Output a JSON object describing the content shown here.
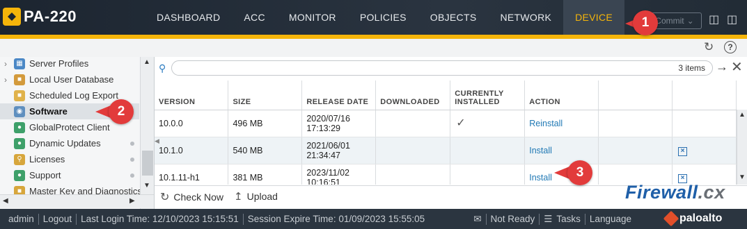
{
  "app": {
    "title": "PA-220"
  },
  "nav": {
    "items": [
      "DASHBOARD",
      "ACC",
      "MONITOR",
      "POLICIES",
      "OBJECTS",
      "NETWORK",
      "DEVICE"
    ],
    "active": "DEVICE",
    "commit_label": "Commit"
  },
  "sidebar": {
    "items": [
      {
        "label": "Server Profiles",
        "icon": "server-profiles-icon"
      },
      {
        "label": "Local User Database",
        "icon": "user-database-icon"
      },
      {
        "label": "Scheduled Log Export",
        "icon": "log-export-icon"
      },
      {
        "label": "Software",
        "icon": "software-icon"
      },
      {
        "label": "GlobalProtect Client",
        "icon": "globe-icon"
      },
      {
        "label": "Dynamic Updates",
        "icon": "dynamic-updates-icon"
      },
      {
        "label": "Licenses",
        "icon": "key-icon"
      },
      {
        "label": "Support",
        "icon": "support-icon"
      },
      {
        "label": "Master Key and Diagnostics",
        "icon": "lock-icon"
      }
    ],
    "active": "Software"
  },
  "search": {
    "placeholder": "",
    "count": "3 items"
  },
  "table": {
    "headers": [
      "VERSION",
      "SIZE",
      "RELEASE DATE",
      "DOWNLOADED",
      "CURRENTLY INSTALLED",
      "ACTION",
      "",
      ""
    ],
    "rows": [
      {
        "version": "10.0.0",
        "size": "496 MB",
        "date": "2020/07/16",
        "time": "17:13:29",
        "downloaded": "",
        "installed": "✓",
        "action": "Reinstall",
        "delete": ""
      },
      {
        "version": "10.1.0",
        "size": "540 MB",
        "date": "2021/06/01",
        "time": "21:34:47",
        "downloaded": "",
        "installed": "",
        "action": "Install",
        "delete": "×"
      },
      {
        "version": "10.1.11-h1",
        "size": "381 MB",
        "date": "2023/11/02",
        "time": "10:16:51",
        "downloaded": "",
        "installed": "",
        "action": "Install",
        "delete": "×"
      }
    ]
  },
  "actions": {
    "check_now": "Check Now",
    "upload": "Upload"
  },
  "callouts": [
    "1",
    "2",
    "3"
  ],
  "watermark": {
    "text": "Firewall",
    "suffix": ".cx"
  },
  "status": {
    "user": "admin",
    "logout": "Logout",
    "last_login": "Last Login Time: 12/10/2023 15:15:51",
    "session_expire": "Session Expire Time: 01/09/2023 15:55:05",
    "not_ready": "Not Ready",
    "tasks": "Tasks",
    "language": "Language",
    "brand": "paloalto"
  },
  "colors": {
    "accent": "#f5b50a",
    "callout": "#e23b3b",
    "link": "#1f78b4",
    "topbar": "#1c2530"
  }
}
